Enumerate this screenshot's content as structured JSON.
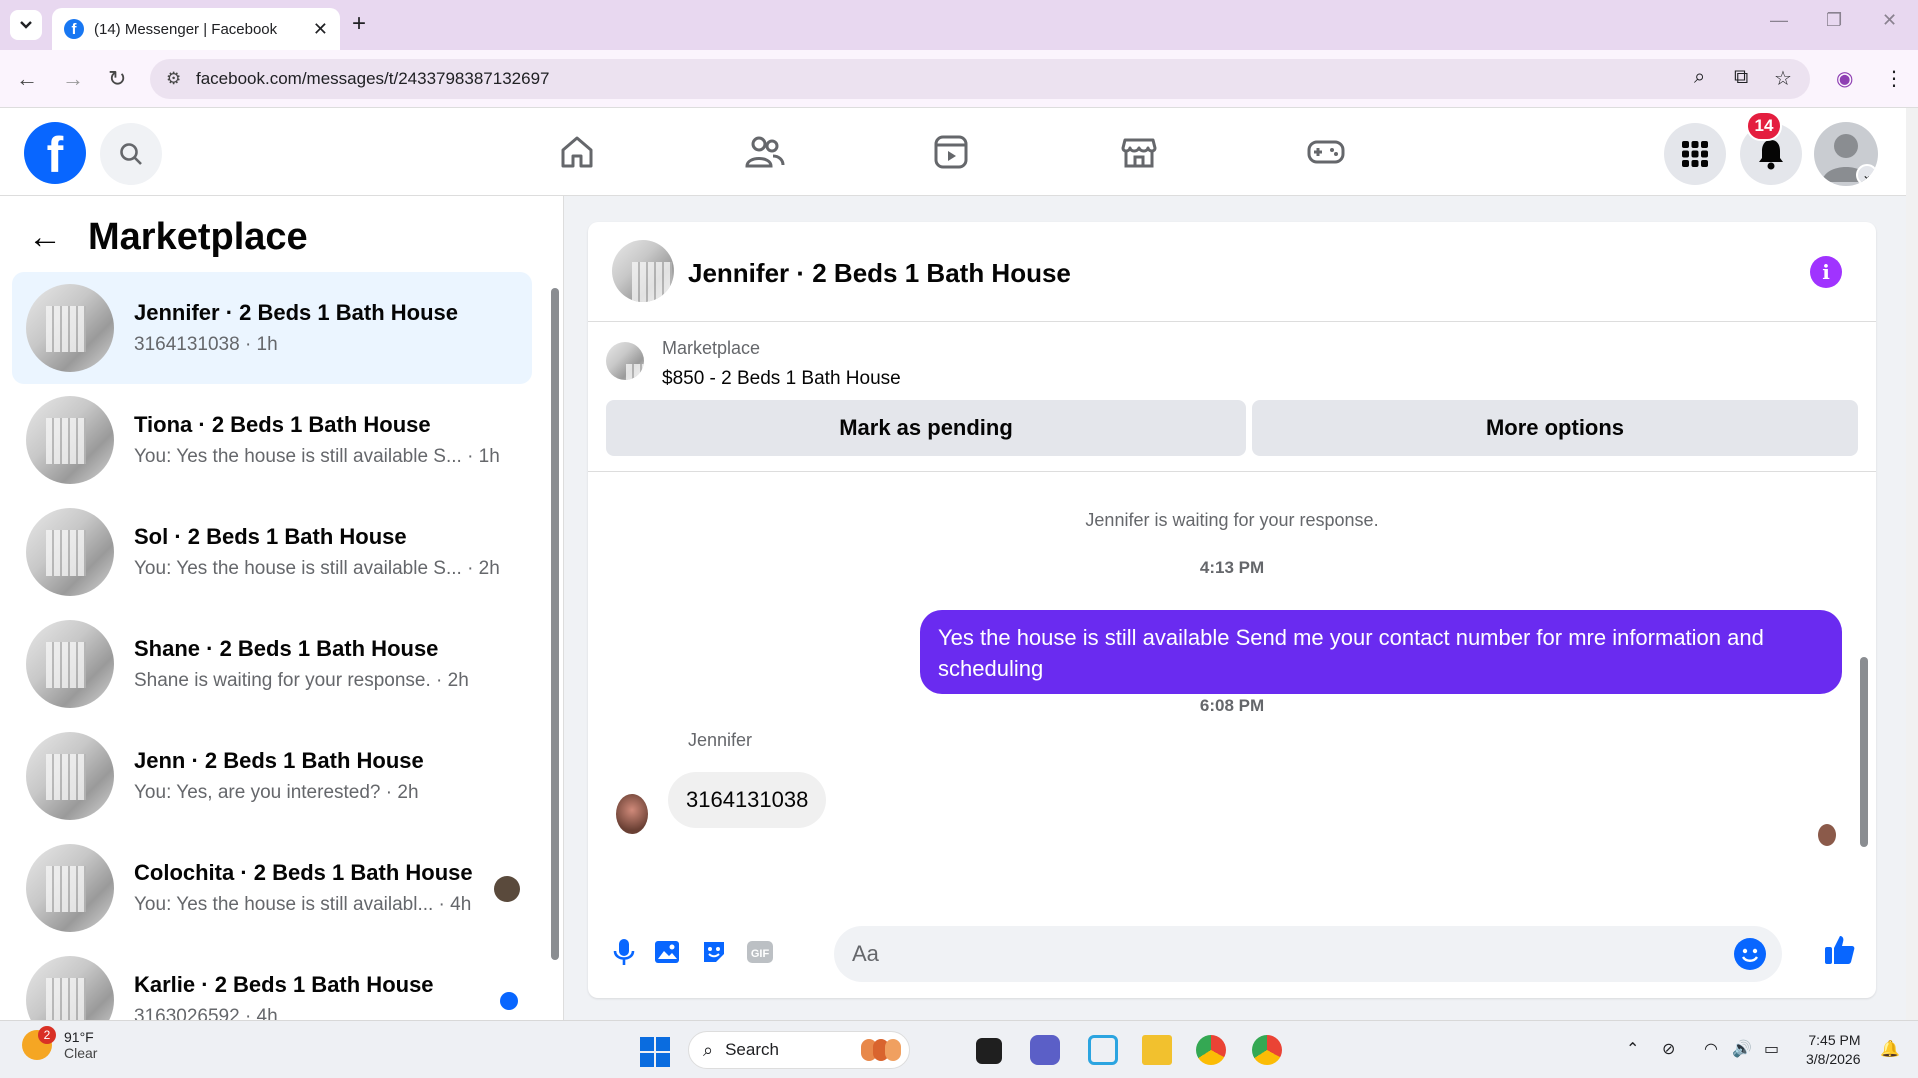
{
  "browser": {
    "tab_title": "(14) Messenger | Facebook",
    "url": "facebook.com/messages/t/2433798387132697"
  },
  "fb_header": {
    "notification_count": "14"
  },
  "sidebar": {
    "title": "Marketplace",
    "conversations": [
      {
        "name": "Jennifer · 2 Beds 1 Bath House",
        "preview": "3164131038 · 1h",
        "active": true
      },
      {
        "name": "Tiona · 2 Beds 1 Bath House",
        "preview": "You: Yes the house is still available S... · 1h"
      },
      {
        "name": "Sol · 2 Beds 1 Bath House",
        "preview": "You: Yes the house is still available S... · 2h"
      },
      {
        "name": "Shane · 2 Beds 1 Bath House",
        "preview": "Shane is waiting for your response. · 2h"
      },
      {
        "name": "Jenn · 2 Beds 1 Bath House",
        "preview": "You: Yes, are you interested? · 2h"
      },
      {
        "name": "Colochita · 2 Beds 1 Bath House",
        "preview": "You: Yes the house is still availabl... · 4h"
      },
      {
        "name": "Karlie · 2 Beds 1 Bath House",
        "preview": "3163026592 · 4h"
      }
    ]
  },
  "chat": {
    "title": "Jennifer · 2 Beds 1 Bath House",
    "listing": {
      "source": "Marketplace",
      "price_title": "$850 - 2 Beds 1 Bath House",
      "mark_pending_label": "Mark as pending",
      "more_options_label": "More options"
    },
    "system_message": "Jennifer is waiting for your response.",
    "timestamp_1": "4:13 PM",
    "outgoing_message": "Yes the house is still available  Send me your contact number for mre information and  scheduling",
    "timestamp_2": "6:08 PM",
    "incoming_sender": "Jennifer",
    "incoming_message": "3164131038",
    "composer_placeholder": "Aa"
  },
  "taskbar": {
    "weather_temp": "91°F",
    "weather_cond": "Clear",
    "weather_badge": "2",
    "search_label": "Search",
    "time": "7:45 PM",
    "date": "3/8/2026"
  },
  "colors": {
    "fb_blue": "#0866ff",
    "outgoing_bubble": "#6a2bf0",
    "info_purple": "#a033ff",
    "badge_red": "#e41e3f"
  }
}
